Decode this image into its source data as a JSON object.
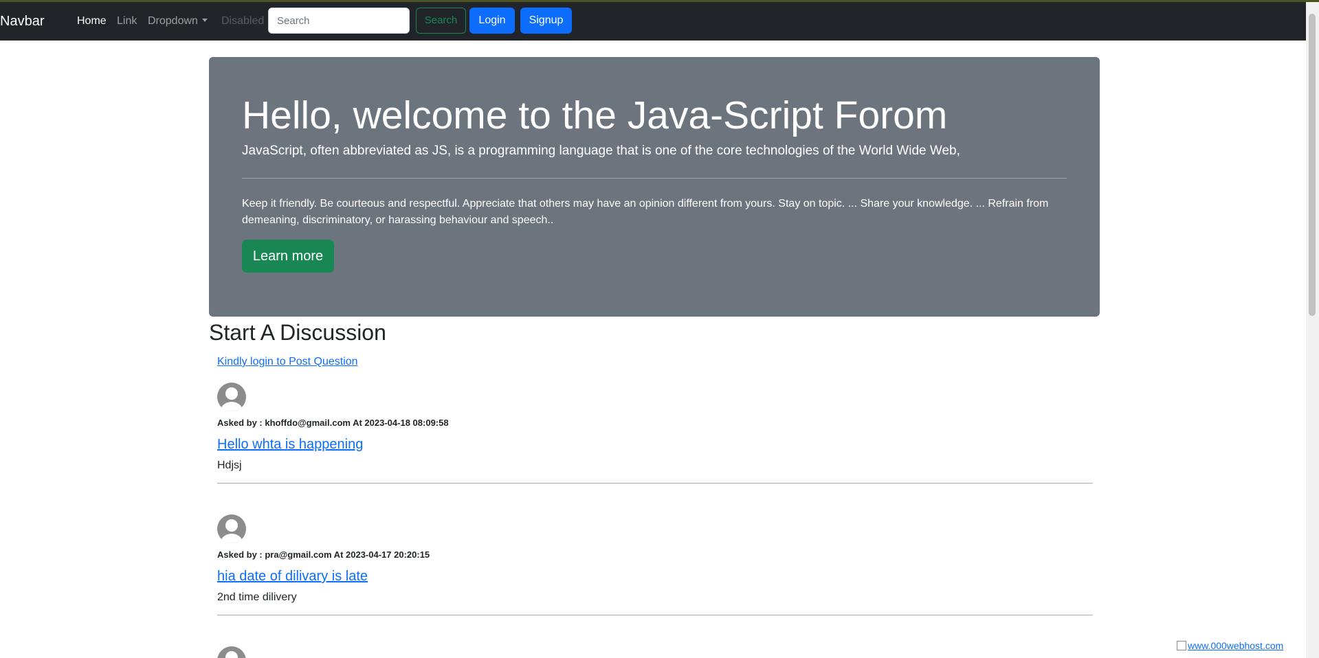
{
  "navbar": {
    "brand": "Navbar",
    "links": [
      {
        "label": "Home",
        "state": "active"
      },
      {
        "label": "Link",
        "state": "normal"
      },
      {
        "label": "Dropdown",
        "state": "dropdown"
      },
      {
        "label": "Disabled",
        "state": "disabled"
      }
    ],
    "search_placeholder": "Search",
    "search_button": "Search",
    "login_button": "Login",
    "signup_button": "Signup"
  },
  "jumbotron": {
    "title": "Hello, welcome to the Java-Script Forom",
    "lead": "JavaScript, often abbreviated as JS, is a programming language that is one of the core technologies of the World Wide Web,",
    "rules": "Keep it friendly. Be courteous and respectful. Appreciate that others may have an opinion different from yours. Stay on topic. ... Share your knowledge. ... Refrain from demeaning, discriminatory, or harassing behaviour and speech..",
    "button": "Learn more"
  },
  "discussion": {
    "heading": "Start A Discussion",
    "login_prompt": "Kindly login to Post Question",
    "questions": [
      {
        "meta": "Asked by : khoffdo@gmail.com At 2023-04-18 08:09:58",
        "title": "Hello whta is happening",
        "description": "Hdjsj"
      },
      {
        "meta": "Asked by : pra@gmail.com At 2023-04-17 20:20:15",
        "title": "hia date of dilivary is late",
        "description": "2nd time dilivery"
      }
    ]
  },
  "footer": {
    "host_link": "www.000webhost.com"
  },
  "colors": {
    "navbar_bg": "#212529",
    "jumbotron_bg": "#6c757d",
    "primary": "#0d6efd",
    "success": "#198754"
  }
}
